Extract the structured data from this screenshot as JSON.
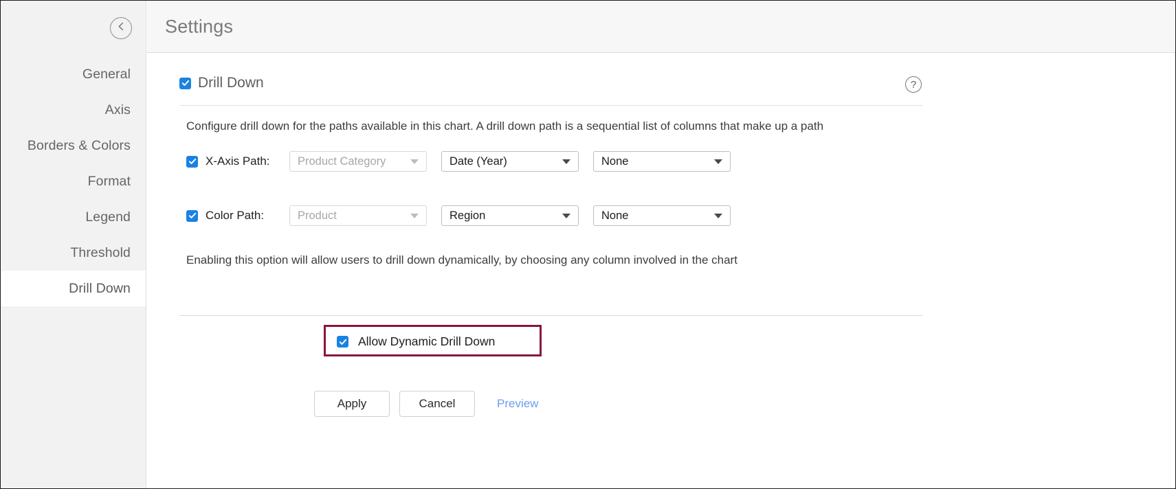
{
  "colors": {
    "accent_checkbox": "#1a82e2",
    "highlight_border": "#8a1538",
    "link": "#6b9ef0",
    "sidebar_bg": "#f2f2f2",
    "header_bg": "#f7f7f7"
  },
  "sidebar": {
    "collapse_icon": "chevron-left-circle-icon",
    "items": [
      {
        "label": "General",
        "active": false
      },
      {
        "label": "Axis",
        "active": false
      },
      {
        "label": "Borders & Colors",
        "active": false
      },
      {
        "label": "Format",
        "active": false
      },
      {
        "label": "Legend",
        "active": false
      },
      {
        "label": "Threshold",
        "active": false
      },
      {
        "label": "Drill Down",
        "active": true
      }
    ]
  },
  "header": {
    "title": "Settings"
  },
  "main": {
    "section": {
      "checkbox_checked": true,
      "title": "Drill Down",
      "help_icon": "question-mark-circle-icon",
      "help_glyph": "?"
    },
    "paths_description": "Configure drill down for the paths available in this chart. A drill down path is a sequential list of columns that make up a path",
    "rows": [
      {
        "id": "x-axis-path",
        "checkbox_checked": true,
        "label": "X-Axis Path:",
        "selects": [
          {
            "value": "Product Category",
            "disabled": true
          },
          {
            "value": "Date (Year)",
            "disabled": false
          },
          {
            "value": "None",
            "disabled": false
          }
        ]
      },
      {
        "id": "color-path",
        "checkbox_checked": true,
        "label": "Color Path:",
        "selects": [
          {
            "value": "Product",
            "disabled": true
          },
          {
            "value": "Region",
            "disabled": false
          },
          {
            "value": "None",
            "disabled": false
          }
        ]
      }
    ],
    "dynamic_description": "Enabling this option will allow users to drill down dynamically, by choosing any column involved in the chart",
    "dynamic_option": {
      "checkbox_checked": true,
      "label": "Allow Dynamic Drill Down",
      "highlighted": true
    },
    "buttons": {
      "apply": "Apply",
      "cancel": "Cancel",
      "preview": "Preview"
    }
  }
}
